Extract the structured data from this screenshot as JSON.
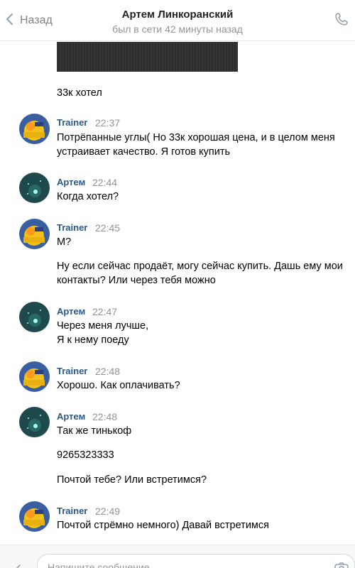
{
  "header": {
    "back_label": "Назад",
    "title": "Артем Линкоранский",
    "subtitle": "был в сети 42 минуты назад"
  },
  "composer": {
    "placeholder": "Напишите сообщение..."
  },
  "messages": [
    {
      "text": "33к хотел"
    },
    {
      "author": "Trainer",
      "time": "22:37",
      "lines": [
        "Потрёпанные углы( Но 33к хорошая цена, и в целом меня",
        "устраивает качество. Я готов купить"
      ]
    },
    {
      "author": "Артем",
      "time": "22:44",
      "lines": [
        "Когда хотел?"
      ]
    },
    {
      "author": "Trainer",
      "time": "22:45",
      "lines": [
        "М?",
        "Ну если сейчас продаёт, могу сейчас купить. Дашь ему мои",
        "контакты? Или через тебя можно"
      ]
    },
    {
      "author": "Артем",
      "time": "22:47",
      "lines": [
        "Через меня лучше,",
        "Я к нему поеду"
      ]
    },
    {
      "author": "Trainer",
      "time": "22:48",
      "lines": [
        "Хорошо. Как оплачивать?"
      ]
    },
    {
      "author": "Артем",
      "time": "22:48",
      "lines": [
        "Так же тинькоф",
        "9265323333",
        "Почтой тебе? Или встретимся?"
      ]
    },
    {
      "author": "Trainer",
      "time": "22:49",
      "lines": [
        "Почтой стрёмно немного) Давай встретимся"
      ]
    }
  ],
  "colors": {
    "author": "#2a5885",
    "time": "#939393",
    "header_subtitle": "#939393"
  },
  "icons": {
    "back": "chevron-left-icon",
    "call": "phone-icon",
    "attach": "paperclip-icon",
    "camera": "camera-icon"
  }
}
